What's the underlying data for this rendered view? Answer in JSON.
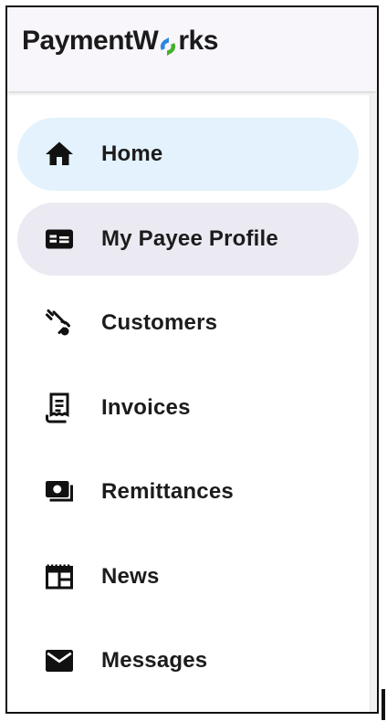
{
  "brand": {
    "logo_prefix": "PaymentW",
    "logo_suffix": "rks",
    "logo_accent_colors": [
      "#2e86de",
      "#43b02a"
    ]
  },
  "nav": {
    "items": [
      {
        "label": "Home",
        "icon": "home-icon"
      },
      {
        "label": "My Payee Profile",
        "icon": "id-card-icon"
      },
      {
        "label": "Customers",
        "icon": "customers-icon"
      },
      {
        "label": "Invoices",
        "icon": "receipt-icon"
      },
      {
        "label": "Remittances",
        "icon": "payments-icon"
      },
      {
        "label": "News",
        "icon": "newspaper-icon"
      },
      {
        "label": "Messages",
        "icon": "envelope-icon"
      }
    ],
    "active_color": "#e3f2fc",
    "selected_color": "#ebe9f2"
  }
}
